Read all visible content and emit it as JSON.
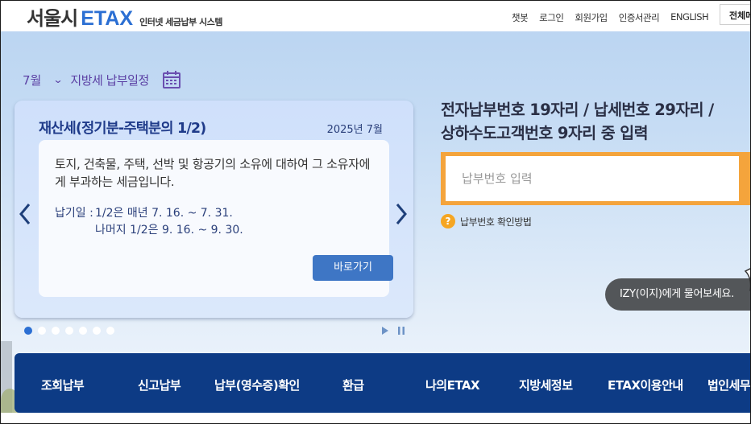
{
  "header": {
    "logo_main": "서울시",
    "logo_etax": "ETAX",
    "logo_sub": "인터넷 세금납부 시스템",
    "nav": [
      "챗봇",
      "로그인",
      "회원가입",
      "인증서관리",
      "ENGLISH"
    ],
    "all_menu": "전체메뉴"
  },
  "schedule": {
    "month": "7월",
    "title": "지방세 납부일정"
  },
  "card": {
    "title": "재산세(정기분-주택분의 1/2)",
    "date": "2025년 7월",
    "description": "토지, 건축물, 주택, 선박 및 항공기의 소유에 대하여 그 소유자에게 부과하는 세금입니다.",
    "due_label": "납기일 :",
    "due_line1": "1/2은 매년 7. 16. ~ 7. 31.",
    "due_line2": "나머지 1/2은 9. 16. ~ 9. 30.",
    "button": "바로가기",
    "slide_count": 7,
    "active_slide": 1
  },
  "payment": {
    "heading_line1": "전자납부번호 19자리 / 납세번호 29자리 /",
    "heading_line2": "상하수도고객번호 9자리 중 입력",
    "input_placeholder": "납부번호 입력",
    "help_icon": "?",
    "help_text": "납부번호 확인방법"
  },
  "chatbot": {
    "text": "IZY(이지)에게 물어보세요."
  },
  "main_nav": [
    "조회납부",
    "신고납부",
    "납부(영수증)확인",
    "환급",
    "나의ETAX",
    "지방세정보",
    "ETAX이용안내",
    "법인세무"
  ],
  "colors": {
    "brand_blue": "#2b6fd3",
    "nav_navy": "#0d3b85",
    "accent_orange": "#f4a43c",
    "schedule_purple": "#5a3ea3"
  }
}
